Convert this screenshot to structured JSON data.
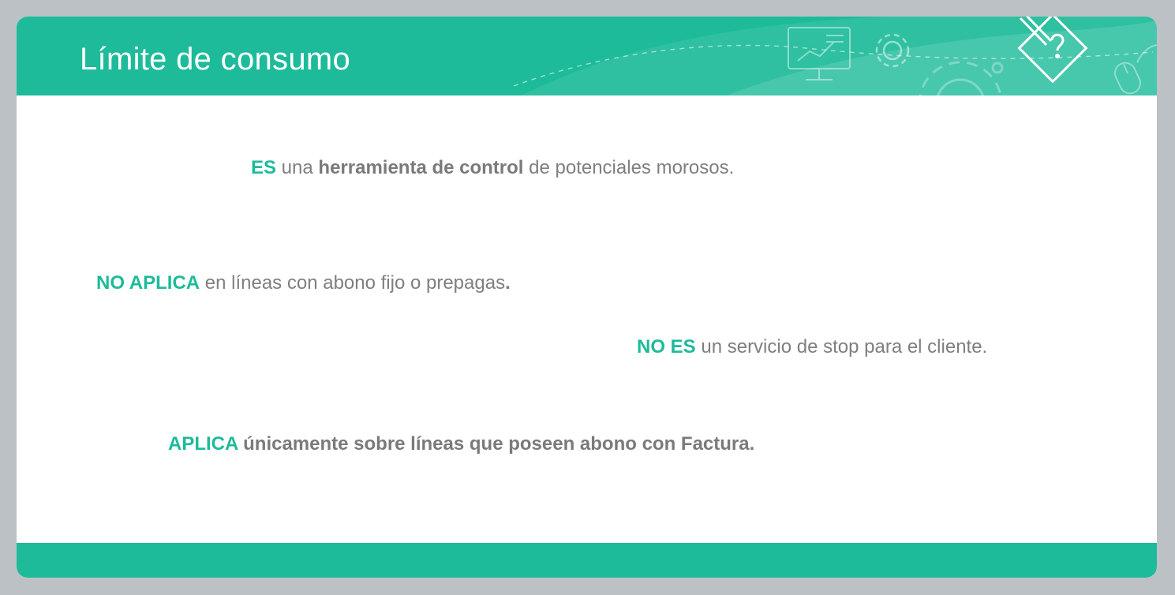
{
  "header": {
    "title": "Límite de consumo",
    "icons": [
      "presentation-board-icon",
      "gear-icon",
      "large-gear-icon",
      "pencil-question-diamond-icon",
      "mouse-icon"
    ]
  },
  "colors": {
    "accent": "#1dbb9a",
    "text": "#7f7f7f",
    "background": "#bcc1c5",
    "card": "#ffffff"
  },
  "lines": [
    {
      "accent": "ES",
      "t1": " una ",
      "bold": "herramienta de control",
      "t2": " de potenciales morosos."
    },
    {
      "accent": "NO APLICA",
      "t1": " en líneas con abono fijo o prepagas",
      "bold": "."
    },
    {
      "accent": "NO ES",
      "t1": " un servicio de stop para el cliente."
    },
    {
      "accent": "APLICA",
      "bold": " únicamente sobre líneas que poseen abono con Factura."
    }
  ]
}
